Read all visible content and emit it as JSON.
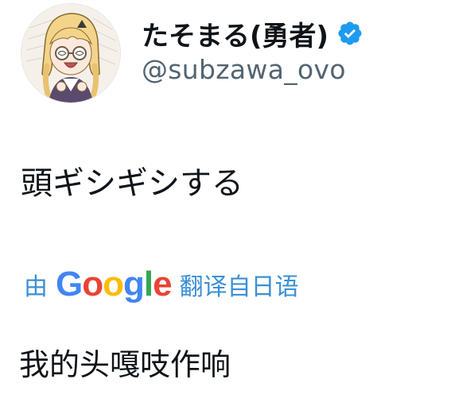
{
  "user": {
    "display_name": "たそまる(勇者)",
    "handle": "@subzawa_ovo",
    "verified": true,
    "verified_color": "#1d9bf0",
    "avatar_icon": "avatar-anime-character"
  },
  "tweet": {
    "text": "頭ギシギシする"
  },
  "translation": {
    "by_label": "由",
    "provider_letters": [
      "G",
      "o",
      "o",
      "g",
      "l",
      "e"
    ],
    "provider_colors": [
      "#4285F4",
      "#EA4335",
      "#FBBC05",
      "#4285F4",
      "#34A853",
      "#EA4335"
    ],
    "from_label": "翻译自日语",
    "link_color": "#3b8fd6",
    "translated_text": "我的头嘎吱作响"
  }
}
